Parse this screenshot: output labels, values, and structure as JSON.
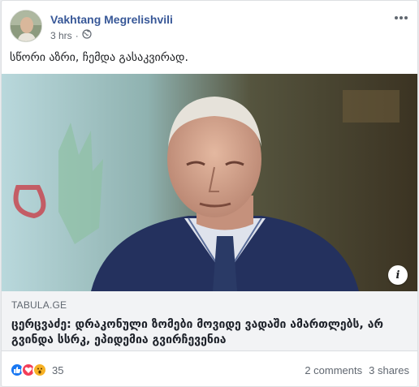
{
  "post": {
    "author": "Vakhtang Megrelishvili",
    "time": "3 hrs",
    "separator": "·",
    "privacy_icon": "globe-icon",
    "text": "სწორი აზრი, ჩემდა გასაკვირად.",
    "more_icon": "more-options-icon"
  },
  "link": {
    "domain": "TABULA.GE",
    "headline_line1": "ცერცვაძე: დრაკონული ზომები მოვიდე ვადაში ამართლებს, არ",
    "headline_line2": "გვინდა სსრკ, ეპიდემია გვირჩევენია",
    "info_label": "i"
  },
  "footer": {
    "reaction_count": "35",
    "comments": "2 comments",
    "shares": "3 shares",
    "reactions": [
      "like",
      "love",
      "wow"
    ]
  },
  "colors": {
    "link_blue": "#385898",
    "like_blue": "#1877f2",
    "love_red": "#f33e58",
    "wow_yellow": "#f7b125"
  }
}
